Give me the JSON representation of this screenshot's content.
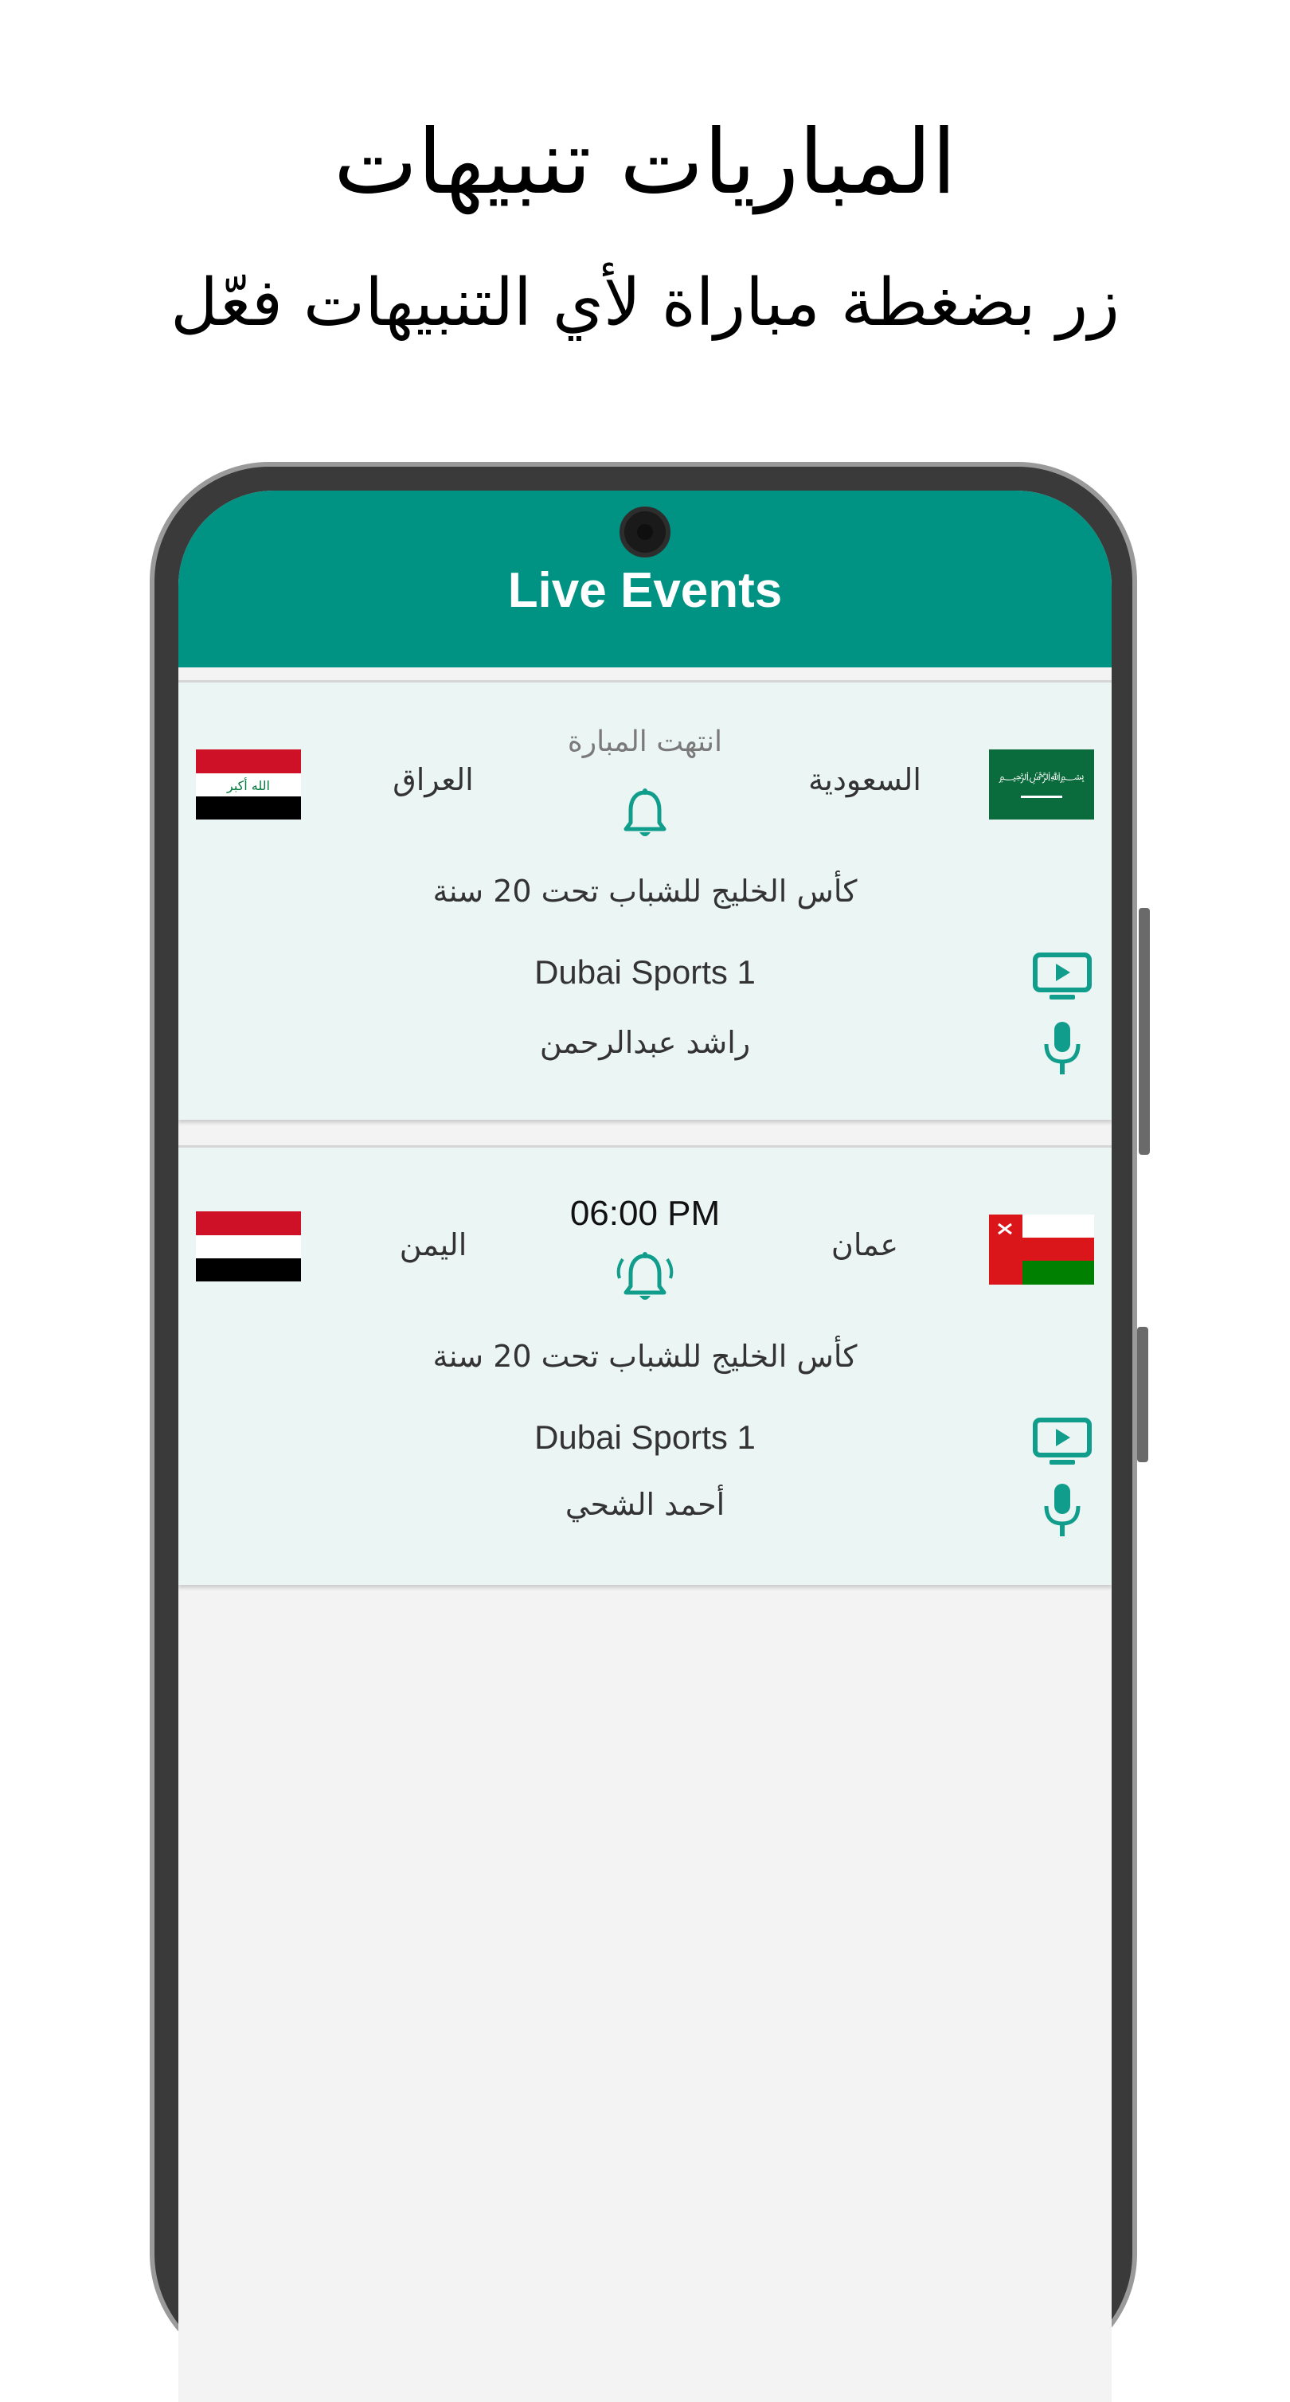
{
  "promo": {
    "title": "المباريات تنبيهات",
    "subtitle": "زر بضغطة مباراة لأي التنبيهات فعّل"
  },
  "app": {
    "title": "Live Events",
    "accent": "#009282"
  },
  "matches": [
    {
      "home_team": "السعودية",
      "away_team": "العراق",
      "status": "انتهت المبارة",
      "league": "كأس الخليج للشباب تحت 20 سنة",
      "channel": "Dubai Sports 1",
      "commentator": "راشد عبدالرحمن",
      "home_flag_icon": "saudi-flag-icon",
      "away_flag_icon": "iraq-flag-icon",
      "bell_icon": "bell-icon"
    },
    {
      "home_team": "عمان",
      "away_team": "اليمن",
      "time": "06:00 PM",
      "league": "كأس الخليج للشباب تحت 20 سنة",
      "channel": "Dubai Sports 1",
      "commentator": "أحمد الشحي",
      "home_flag_icon": "oman-flag-icon",
      "away_flag_icon": "yemen-flag-icon",
      "bell_icon": "bell-ringing-icon"
    }
  ]
}
